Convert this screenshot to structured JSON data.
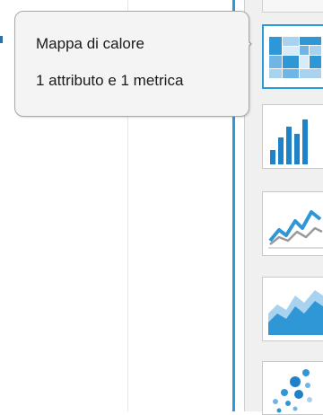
{
  "tooltip": {
    "title": "Mappa di calore",
    "subtitle": "1 attributo e 1 metrica"
  },
  "gallery": {
    "items": [
      {
        "name": "heatmap",
        "icon": "heatmap-icon",
        "selected": true
      },
      {
        "name": "bar",
        "icon": "bar-chart-icon",
        "selected": false
      },
      {
        "name": "line",
        "icon": "line-chart-icon",
        "selected": false
      },
      {
        "name": "area",
        "icon": "area-chart-icon",
        "selected": false
      },
      {
        "name": "bubble",
        "icon": "bubble-chart-icon",
        "selected": false
      }
    ]
  },
  "colors": {
    "accent": "#2a9bd8",
    "chart_blue": "#2f97d6",
    "chart_light": "#a9d2ef",
    "tooltip_bg": "#f4f4f4"
  }
}
